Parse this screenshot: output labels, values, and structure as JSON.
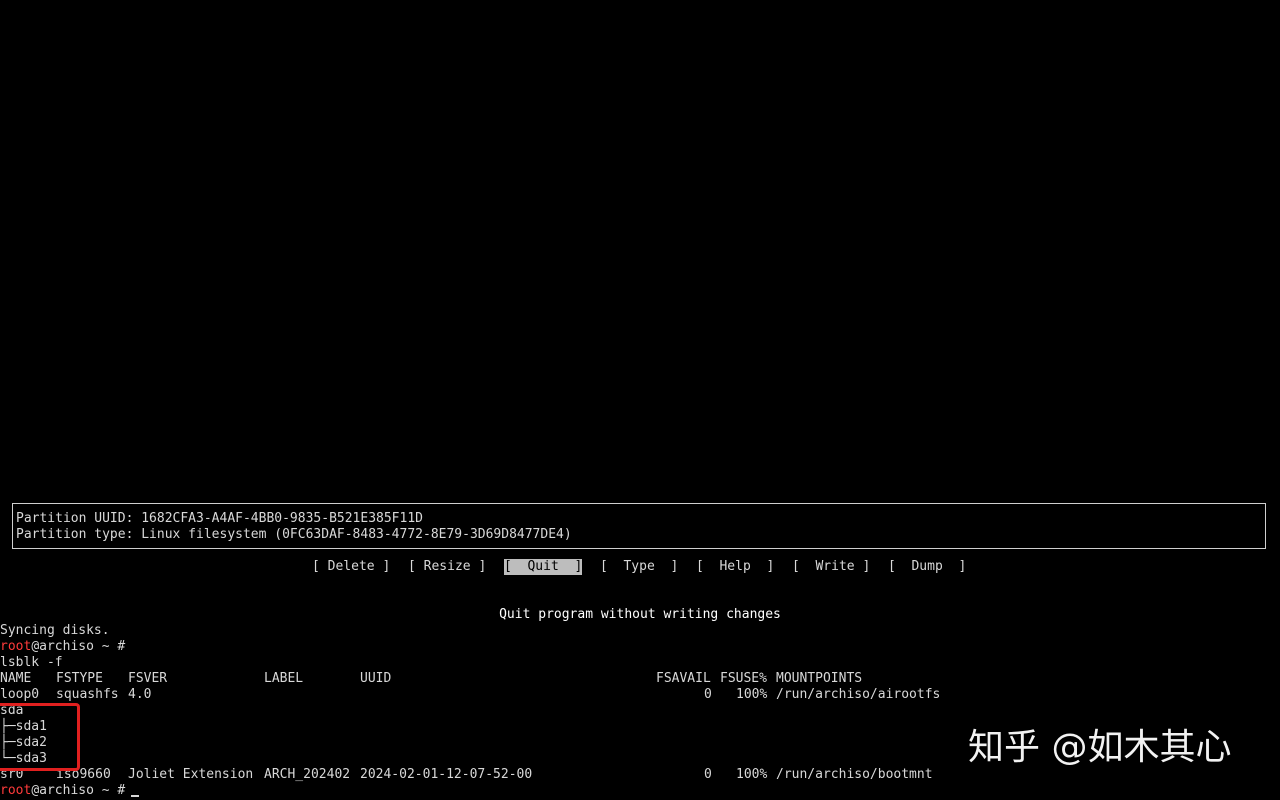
{
  "window": {
    "type": "linux-console"
  },
  "cfdisk": {
    "partition_uuid_line": "Partition UUID: 1682CFA3-A4AF-4BB0-9835-B521E385F11D",
    "partition_type_line": "Partition type: Linux filesystem (0FC63DAF-8483-4772-8E79-3D69D8477DE4)",
    "menu": {
      "delete": "[ Delete ]",
      "resize": "[ Resize ]",
      "quit": "[  Quit  ]",
      "type": "[  Type  ]",
      "help": "[  Help  ]",
      "write": "[  Write ]",
      "dump": "[  Dump  ]"
    },
    "selected_item": "Quit",
    "hint": "Quit program without writing changes"
  },
  "terminal": {
    "syncing": "Syncing disks.",
    "prompt_user": "root",
    "prompt_rest": "@archiso ~ #",
    "command": "lsblk -f",
    "headers": {
      "name": "NAME",
      "fstype": "FSTYPE",
      "fsver": "FSVER",
      "label": "LABEL",
      "uuid": "UUID",
      "fsavail": "FSAVAIL",
      "fsuse": "FSUSE%",
      "mountpoints": "MOUNTPOINTS"
    },
    "rows": [
      {
        "name": "loop0",
        "fstype": "squashfs",
        "fsver": "4.0",
        "label": "",
        "uuid": "",
        "fsavail": "0",
        "fsuse": "100%",
        "mountpoints": "/run/archiso/airootfs"
      },
      {
        "name": "sda",
        "fstype": "",
        "fsver": "",
        "label": "",
        "uuid": "",
        "fsavail": "",
        "fsuse": "",
        "mountpoints": ""
      },
      {
        "name": "├─sda1",
        "fstype": "",
        "fsver": "",
        "label": "",
        "uuid": "",
        "fsavail": "",
        "fsuse": "",
        "mountpoints": ""
      },
      {
        "name": "├─sda2",
        "fstype": "",
        "fsver": "",
        "label": "",
        "uuid": "",
        "fsavail": "",
        "fsuse": "",
        "mountpoints": ""
      },
      {
        "name": "└─sda3",
        "fstype": "",
        "fsver": "",
        "label": "",
        "uuid": "",
        "fsavail": "",
        "fsuse": "",
        "mountpoints": ""
      },
      {
        "name": "sr0",
        "fstype": "iso9660",
        "fsver": "Joliet Extension",
        "label": "ARCH_202402",
        "uuid": "2024-02-01-12-07-52-00",
        "fsavail": "0",
        "fsuse": "100%",
        "mountpoints": "/run/archiso/bootmnt"
      }
    ]
  },
  "watermark": "知乎 @如木其心",
  "colors": {
    "background": "#000000",
    "text": "#d8d8d8",
    "prompt_user": "#ff3b3b",
    "menu_selected_bg": "#bdbdbd",
    "annotation_box": "#e0201f"
  }
}
